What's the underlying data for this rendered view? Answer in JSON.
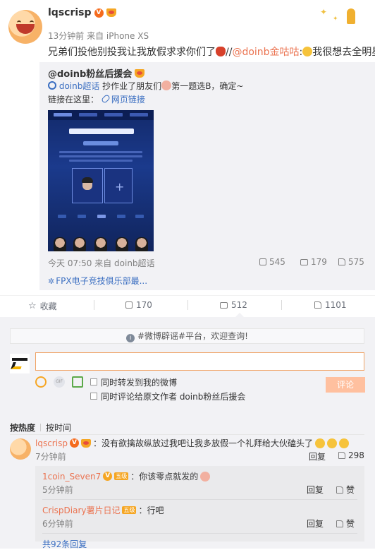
{
  "post": {
    "author": "lqscrisp",
    "meta": "13分钟前 来自 iPhone XS",
    "text_part1": "兄弟们投他别投我让我放假求求你们了",
    "text_part2": "//",
    "mention": "@doinb金咕咕",
    "text_part3": ":",
    "text_part4": "我很想去全明星"
  },
  "repost": {
    "author": "@doinb粉丝后援会",
    "super_topic": "doinb超话",
    "line2_text": " 抄作业了朋友们",
    "line2_text2": "第一题选B，确定~",
    "line3_prefix": "链接在这里：",
    "link_text": "网页链接",
    "meta": "今天 07:50 来自 doinb超话",
    "repost_count": "545",
    "comment_count": "179",
    "like_count": "575",
    "topic": "FPX电子竞技俱乐部最..."
  },
  "actions": {
    "favorite": "收藏",
    "repost": "170",
    "comment": "512",
    "like": "1101"
  },
  "comment_box": {
    "notice": "#微博辟谣#平台，欢迎查询!",
    "input_value": "",
    "check1": "同时转发到我的微博",
    "check2": "同时评论给原文作者 doinb粉丝后援会",
    "submit": "评论",
    "gif_label": "GIF"
  },
  "sort": {
    "by_hot": "按热度",
    "by_time": "按时间"
  },
  "comments": [
    {
      "name": "lqscrisp",
      "text": "：没有欲擒故纵放过我吧让我多放假一个礼拜给大伙磕头了",
      "time": "7分钟前",
      "reply": "回复",
      "likes": "298"
    }
  ],
  "replies": [
    {
      "name": "1coin_Seven7",
      "badge": "五级",
      "text": "：你该零点就发的",
      "time": "5分钟前",
      "reply": "回复",
      "like": "赞"
    },
    {
      "name": "CrispDiary薯片日记",
      "badge": "五级",
      "text": "：行吧",
      "time": "6分钟前",
      "reply": "回复",
      "like": "赞"
    }
  ],
  "more_replies": "共92条回复",
  "colors": {
    "accent": "#eb7350",
    "link": "#3a6ec1",
    "panel": "#f2f2f5"
  }
}
